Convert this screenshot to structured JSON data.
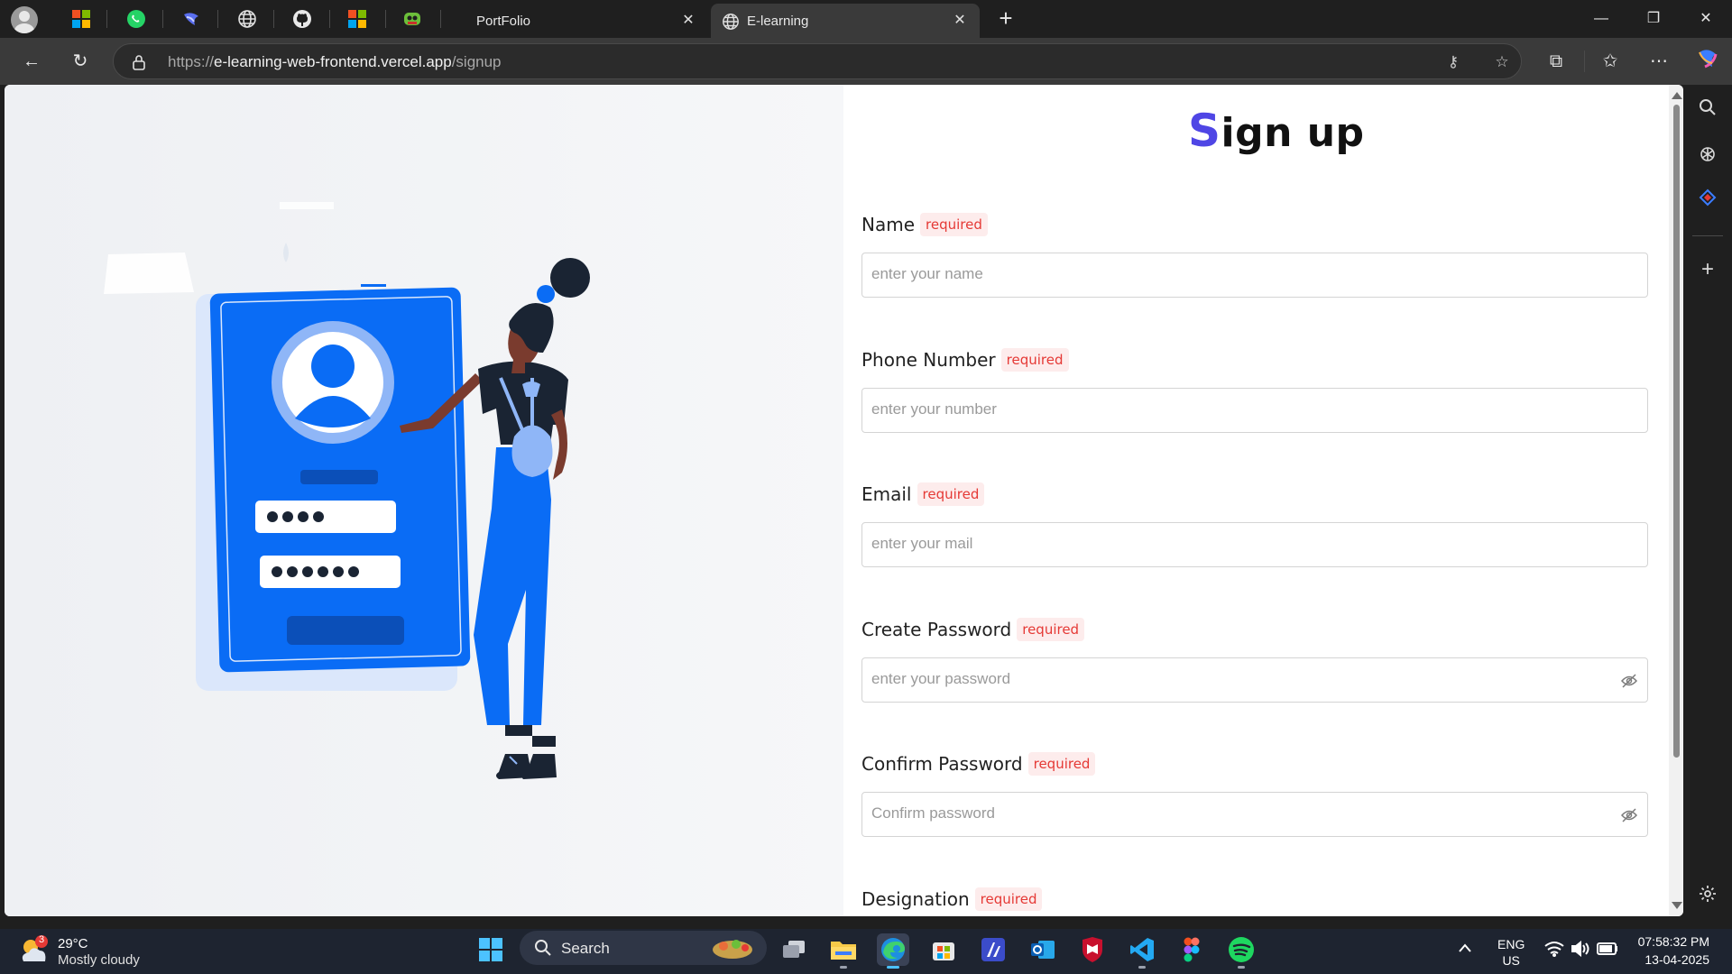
{
  "browser": {
    "tabs": [
      {
        "title": "PortFolio",
        "active": false
      },
      {
        "title": "E-learning",
        "active": true
      }
    ],
    "url": {
      "prefix": "https://",
      "host": "e-learning-web-frontend.vercel.app",
      "path": "/signup"
    },
    "pinned_icons": [
      "microsoft-store-icon",
      "whatsapp-icon",
      "copilot-pinned-icon",
      "globe-icon",
      "github-icon",
      "microsoft-icon",
      "app-icon"
    ]
  },
  "page": {
    "title_first_letter": "S",
    "title_rest": "ign up",
    "required_label": "required",
    "fields": [
      {
        "label": "Name",
        "placeholder": "enter your name",
        "password": false
      },
      {
        "label": "Phone Number",
        "placeholder": "enter your number",
        "password": false
      },
      {
        "label": "Email",
        "placeholder": "enter your mail",
        "password": false
      },
      {
        "label": "Create Password",
        "placeholder": "enter your password",
        "password": true
      },
      {
        "label": "Confirm Password",
        "placeholder": "Confirm password",
        "password": true
      },
      {
        "label": "Designation",
        "placeholder": "",
        "password": false
      }
    ]
  },
  "taskbar": {
    "weather": {
      "badge": "3",
      "temp": "29°C",
      "condition": "Mostly cloudy"
    },
    "search_label": "Search",
    "language": {
      "line1": "ENG",
      "line2": "US"
    },
    "time": "07:58:32 PM",
    "date": "13-04-2025"
  },
  "colors": {
    "accent": "#4f46e5",
    "illustration_blue": "#0a6cf5",
    "required_text": "#e53935"
  }
}
